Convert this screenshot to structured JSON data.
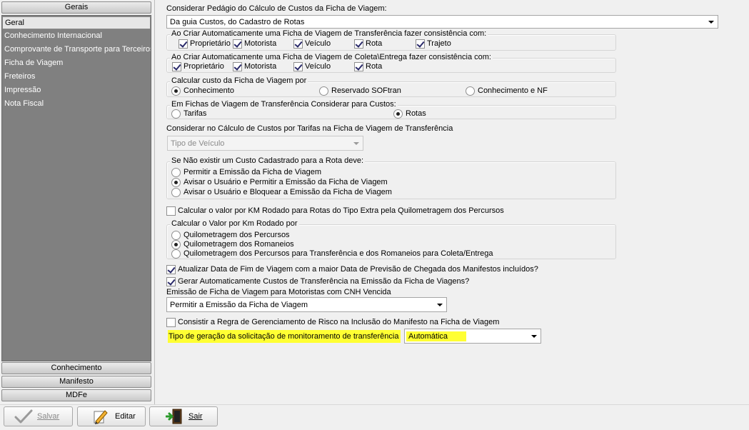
{
  "nav": {
    "top_header": "Gerais",
    "items": [
      {
        "label": "Geral",
        "selected": true
      },
      {
        "label": "Conhecimento Internacional",
        "selected": false
      },
      {
        "label": "Comprovante de Transporte para Terceiros",
        "selected": false
      },
      {
        "label": "Ficha de Viagem",
        "selected": false
      },
      {
        "label": "Freteiros",
        "selected": false
      },
      {
        "label": "Impressão",
        "selected": false
      },
      {
        "label": "Nota Fiscal",
        "selected": false
      }
    ],
    "bottom_headers": [
      "Conhecimento",
      "Manifesto",
      "MDFe"
    ]
  },
  "form": {
    "pedagio": {
      "label": "Considerar Pedágio do Cálculo de Custos da Ficha de Viagem:",
      "value": "Da guia Custos, do Cadastro de Rotas"
    },
    "transferencia_consistencia": {
      "title": "Ao Criar Automaticamente uma Ficha de Viagem de Transferência fazer consistência com:",
      "options": [
        {
          "label": "Proprietário",
          "checked": true
        },
        {
          "label": "Motorista",
          "checked": true
        },
        {
          "label": "Veículo",
          "checked": true
        },
        {
          "label": "Rota",
          "checked": true
        },
        {
          "label": "Trajeto",
          "checked": true
        }
      ]
    },
    "coleta_consistencia": {
      "title": "Ao Criar Automaticamente uma Ficha de Viagem de Coleta\\Entrega fazer consistência com:",
      "options": [
        {
          "label": "Proprietário",
          "checked": true
        },
        {
          "label": "Motorista",
          "checked": true
        },
        {
          "label": "Veículo",
          "checked": true
        },
        {
          "label": "Rota",
          "checked": true
        }
      ]
    },
    "calcular_custo": {
      "title": "Calcular custo da Ficha de Viagem por",
      "options": [
        {
          "label": "Conhecimento",
          "checked": true
        },
        {
          "label": "Reservado SOFtran",
          "checked": false
        },
        {
          "label": "Conhecimento e NF",
          "checked": false
        }
      ]
    },
    "transferencia_custos": {
      "title": "Em Fichas de Viagem de Transferência Considerar para Custos:",
      "options": [
        {
          "label": "Tarifas",
          "checked": false
        },
        {
          "label": "Rotas",
          "checked": true
        }
      ]
    },
    "tarifas": {
      "label": "Considerar no Cálculo de Custos por Tarifas na Ficha de Viagem de Transferência",
      "value": "Tipo de Veículo"
    },
    "sem_custo": {
      "title": "Se Não existir um Custo Cadastrado para a Rota deve:",
      "options": [
        {
          "label": "Permitir a Emissão da Ficha de Viagem",
          "checked": false
        },
        {
          "label": "Avisar o Usuário e Permitir a Emissão da Ficha de Viagem",
          "checked": true
        },
        {
          "label": "Avisar o Usuário e Bloquear a Emissão da Ficha de Viagem",
          "checked": false
        }
      ]
    },
    "km_extra": {
      "label": "Calcular o valor por KM Rodado para Rotas do Tipo Extra pela Quilometragem dos Percursos",
      "checked": false
    },
    "valor_km": {
      "title": "Calcular o Valor por Km Rodado por",
      "options": [
        {
          "label": "Quilometragem dos Percursos",
          "checked": false
        },
        {
          "label": "Quilometragem dos Romaneios",
          "checked": true
        },
        {
          "label": "Quilometragem dos Percursos para Transferência e dos Romaneios para Coleta/Entrega",
          "checked": false
        }
      ]
    },
    "atualizar_data": {
      "label": "Atualizar Data de Fim de Viagem com a maior Data de Previsão de Chegada dos Manifestos incluídos?",
      "checked": true
    },
    "gerar_custos": {
      "label": "Gerar Automaticamente Custos de Transferência na Emissão da Ficha de Viagens?",
      "checked": true
    },
    "cnh": {
      "label": "Emissão de Ficha de Viagem para Motoristas com  CNH Vencida",
      "value": "Permitir a Emissão da Ficha de Viagem"
    },
    "risco": {
      "label": "Consistir a Regra de Gerenciamento de Risco na Inclusão do Manifesto na Ficha de Viagem",
      "checked": false
    },
    "monitoramento": {
      "label": "Tipo de geração da solicitação de monitoramento de transferência",
      "value": "Automática",
      "highlight_color": "#ffff33"
    }
  },
  "toolbar": {
    "save_label": "Salvar",
    "edit_label": "Editar",
    "exit_label": "Sair"
  }
}
